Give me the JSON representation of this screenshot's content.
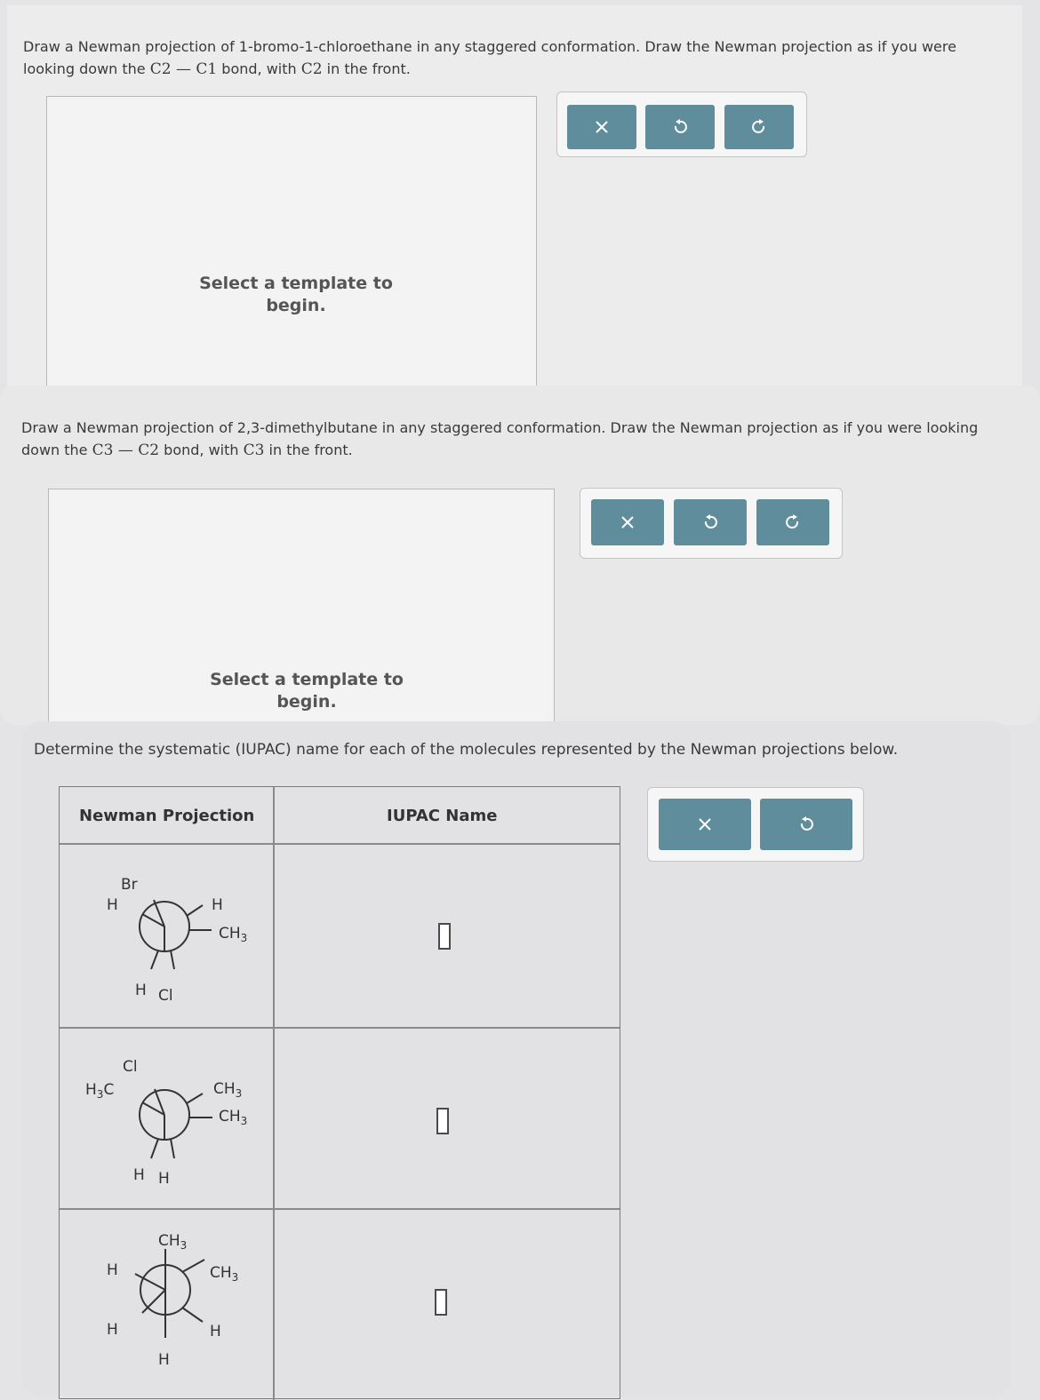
{
  "problem1": {
    "prompt_text": "Draw a Newman projection of 1-bromo-1-chloroethane in any staggered conformation. Draw the Newman projection as if you were looking down the",
    "bond_math": "C2 — C1",
    "prompt_tail": "bond, with",
    "front_carbon": "C2",
    "prompt_end": "in the front.",
    "hint": "Select a template to begin."
  },
  "problem2": {
    "prompt_text": "Draw a Newman projection of 2,3-dimethylbutane in any staggered conformation. Draw the Newman projection as if you were looking down the",
    "bond_math": "C3 — C2",
    "prompt_tail": "bond, with",
    "front_carbon": "C3",
    "prompt_end": "in the front.",
    "hint": "Select a template to begin."
  },
  "problem3": {
    "prompt": "Determine the systematic (IUPAC) name for each of the molecules represented by the Newman projections below.",
    "col_projection": "Newman Projection",
    "col_name": "IUPAC Name",
    "rows": [
      {
        "front": {
          "top": "Br",
          "left": "H",
          "bottom": "H"
        },
        "back": {
          "topright": "H",
          "right": "CH3",
          "bottom": "Cl"
        }
      },
      {
        "front": {
          "top": "Cl",
          "left": "H3C",
          "bottom": "H"
        },
        "back": {
          "topright": "CH3",
          "right": "CH3",
          "bottom": "H"
        }
      },
      {
        "front": {
          "top": "CH3",
          "left": "H",
          "bottom": "H"
        },
        "back": {
          "topright": "CH3",
          "right": "H",
          "bottom": "H"
        }
      }
    ]
  },
  "icons": {
    "clear": "x-icon",
    "undo": "undo-icon",
    "redo": "redo-icon"
  },
  "colors": {
    "button": "#5f8d9b",
    "canvas": "#f3f3f3"
  }
}
